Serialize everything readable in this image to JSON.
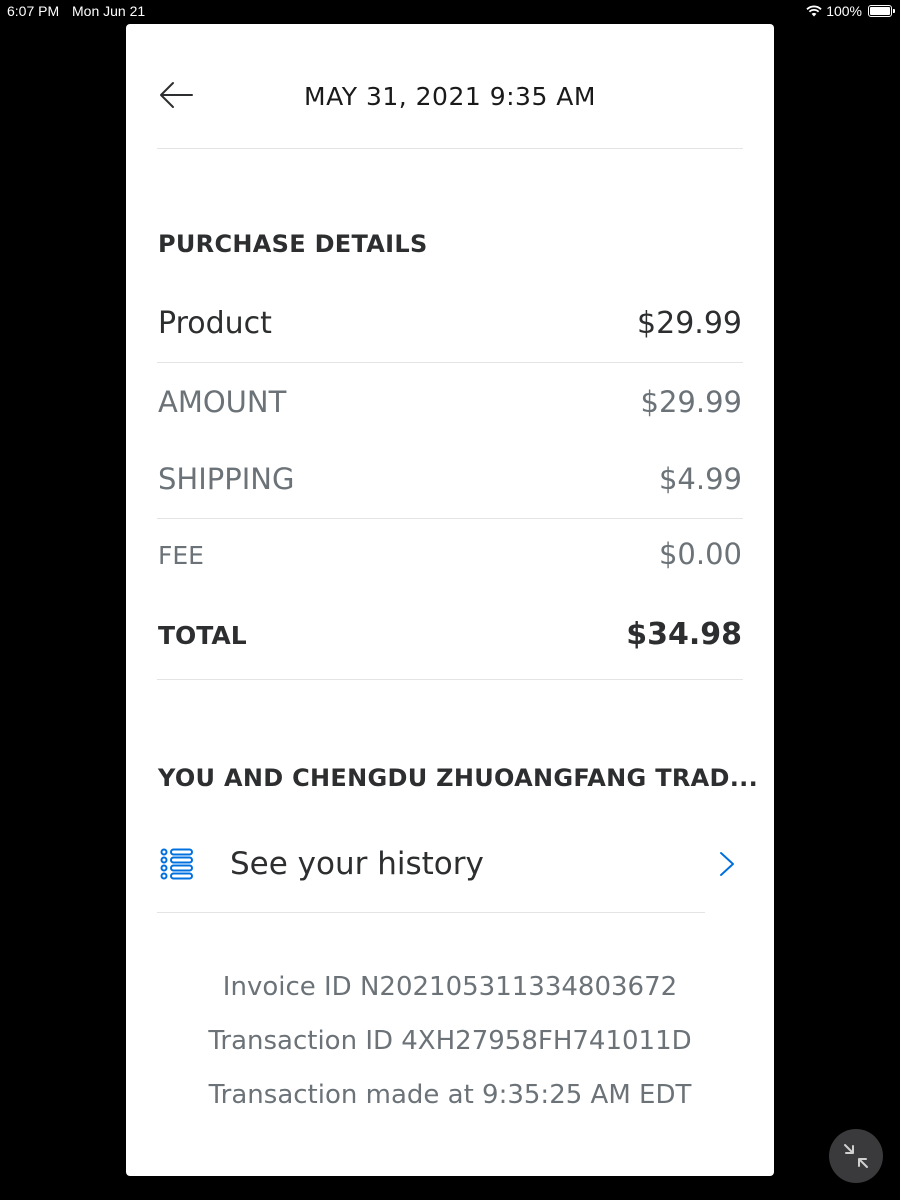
{
  "status_bar": {
    "time": "6:07 PM",
    "date": "Mon Jun 21",
    "battery": "100%"
  },
  "header": {
    "title": "MAY 31, 2021  9:35 AM",
    "back_icon": "arrow-left-icon"
  },
  "purchase": {
    "section_title": "PURCHASE DETAILS",
    "rows": [
      {
        "label": "Product",
        "value": "$29.99"
      },
      {
        "label": "AMOUNT",
        "value": "$29.99"
      },
      {
        "label": "SHIPPING",
        "value": "$4.99"
      },
      {
        "label": "FEE",
        "value": "$0.00"
      },
      {
        "label": "TOTAL",
        "value": "$34.98"
      }
    ]
  },
  "relationship": {
    "section_title": "YOU AND CHENGDU ZHUOANGFANG TRAD...",
    "history_label": "See your history",
    "history_icon": "list-icon",
    "chevron_icon": "chevron-right-icon"
  },
  "details": {
    "invoice": "Invoice ID N202105311334803672",
    "transaction_id": "Transaction ID 4XH27958FH741011D",
    "transaction_time": "Transaction made at 9:35:25 AM EDT"
  },
  "colors": {
    "accent": "#0070e0",
    "text_primary": "#2c2e2f",
    "text_secondary": "#6c7378",
    "divider": "#e4e4e4"
  }
}
